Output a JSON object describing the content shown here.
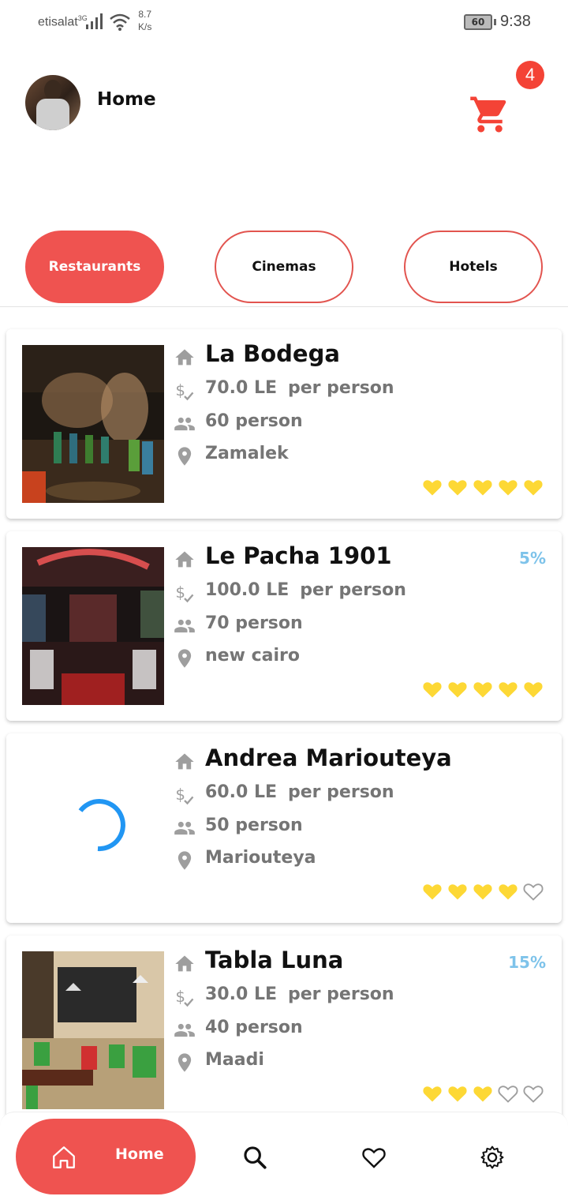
{
  "status_bar": {
    "carrier": "etisalat",
    "network_type": "3G",
    "speed_value": "8.7",
    "speed_unit": "K/s",
    "battery": "60",
    "time": "9:38"
  },
  "header": {
    "title": "Home",
    "cart_count": "4"
  },
  "categories": [
    {
      "label": "Restaurants",
      "active": true
    },
    {
      "label": "Cinemas",
      "active": false
    },
    {
      "label": "Hotels",
      "active": false
    }
  ],
  "places": [
    {
      "name": "La Bodega",
      "price": "70.0 LE",
      "per": "per person",
      "capacity": "60 person",
      "area": "Zamalek",
      "discount": "",
      "rating": 5,
      "image": "restaurant-interior-photo"
    },
    {
      "name": "Le Pacha 1901",
      "price": "100.0 LE",
      "per": "per person",
      "capacity": "70 person",
      "area": "new cairo",
      "discount": "5%",
      "rating": 5,
      "image": "restaurant-interior-photo"
    },
    {
      "name": "Andrea Mariouteya",
      "price": "60.0 LE",
      "per": "per person",
      "capacity": "50 person",
      "area": "Mariouteya",
      "discount": "",
      "rating": 4,
      "image": "loading-spinner"
    },
    {
      "name": "Tabla Luna",
      "price": "30.0 LE",
      "per": "per person",
      "capacity": "40 person",
      "area": "Maadi",
      "discount": "15%",
      "rating": 3,
      "image": "restaurant-interior-photo"
    }
  ],
  "rating_max": 5,
  "bottom_nav": {
    "home_label": "Home",
    "icons": [
      "home-icon",
      "search-icon",
      "heart-icon",
      "settings-gear-icon"
    ]
  },
  "colors": {
    "accent": "#ef5350",
    "badge": "#f44336",
    "discount": "#7ec3ea",
    "heart_filled": "#fdd835",
    "heart_empty": "#9e9e9e",
    "spinner": "#2196f3"
  }
}
